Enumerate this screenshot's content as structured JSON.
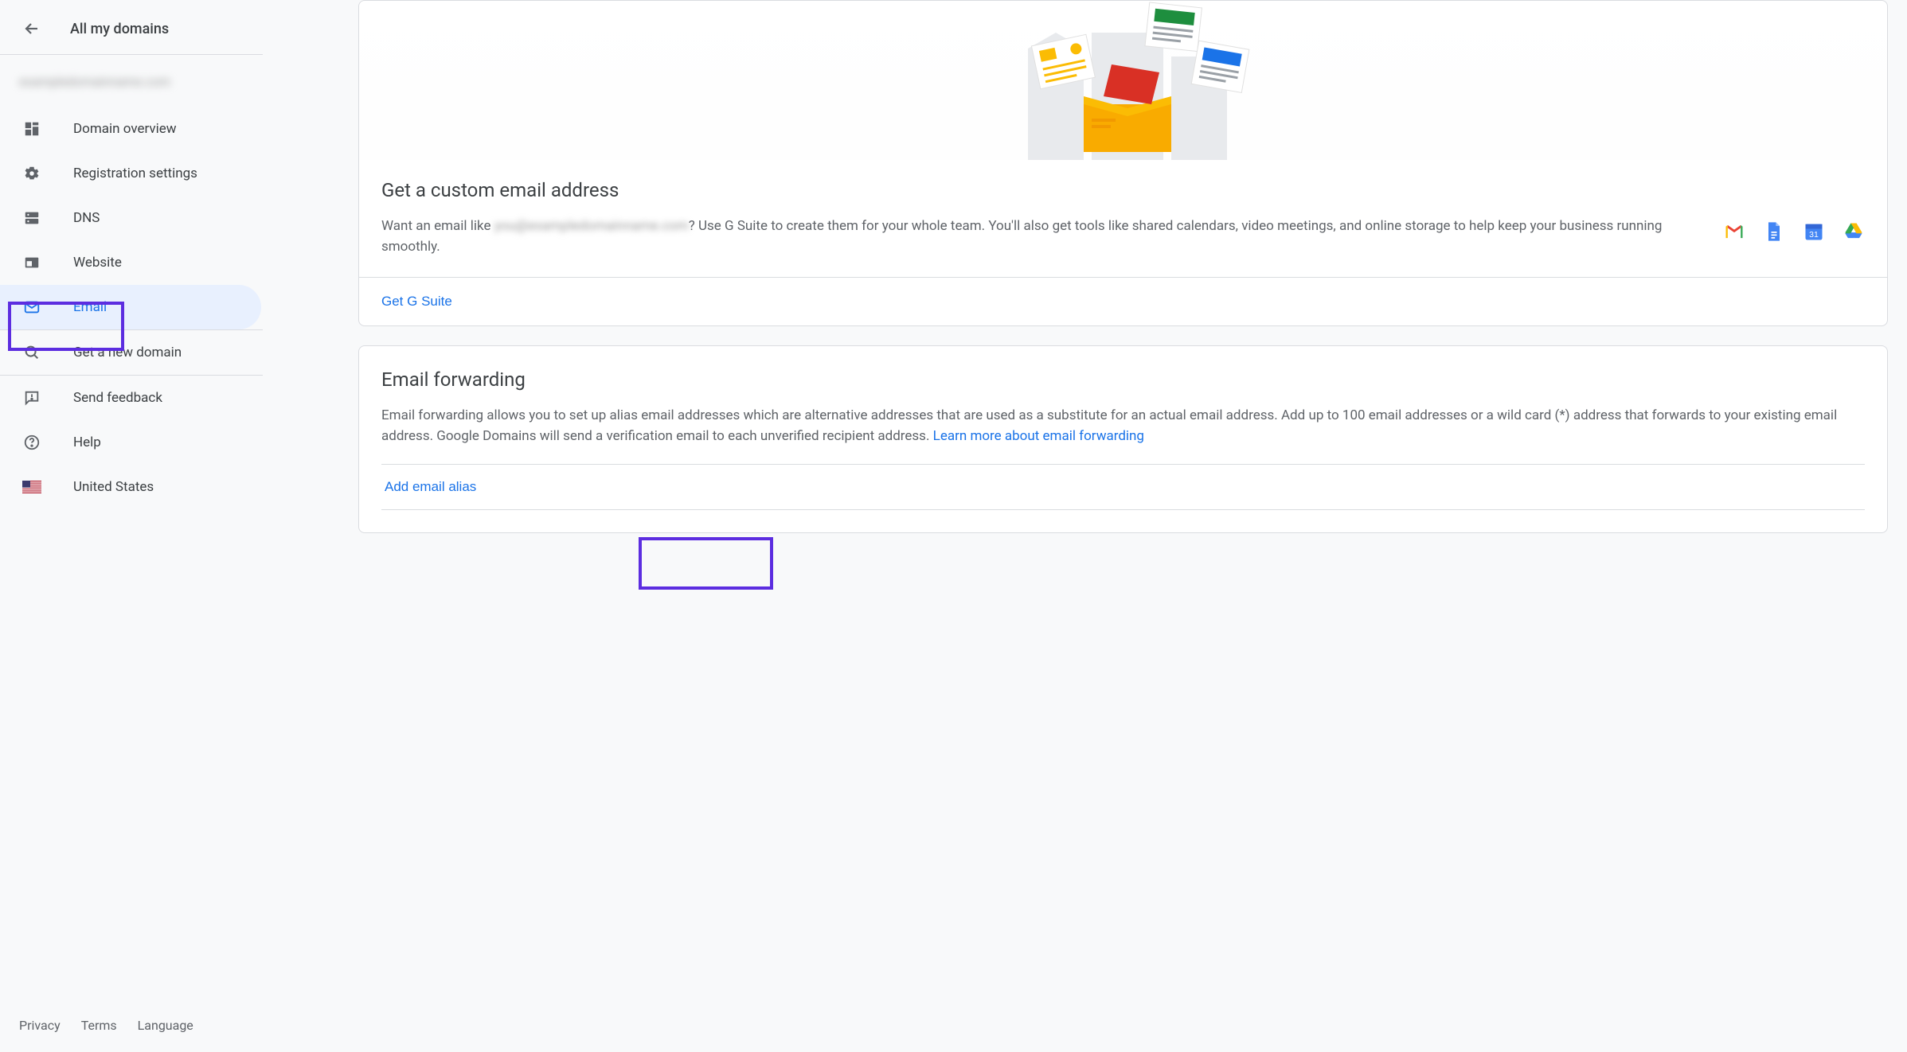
{
  "sidebar": {
    "back_title": "All my domains",
    "domain_placeholder": "exampledomainname.com",
    "items": [
      {
        "label": "Domain overview"
      },
      {
        "label": "Registration settings"
      },
      {
        "label": "DNS"
      },
      {
        "label": "Website"
      },
      {
        "label": "Email"
      },
      {
        "label": "Get a new domain"
      },
      {
        "label": "Send feedback"
      },
      {
        "label": "Help"
      },
      {
        "label": "United States"
      }
    ],
    "footer": {
      "privacy": "Privacy",
      "terms": "Terms",
      "language": "Language"
    }
  },
  "gsuite": {
    "title": "Get a custom email address",
    "text_prefix": "Want an email like ",
    "text_blurred": "you@exampledomainname.com",
    "text_suffix": "? Use G Suite to create them for your whole team. You'll also get tools like shared calendars, video meetings, and online storage to help keep your business running smoothly.",
    "cta": "Get G Suite"
  },
  "forwarding": {
    "title": "Email forwarding",
    "text": "Email forwarding allows you to set up alias email addresses which are alternative addresses that are used as a substitute for an actual email address. Add up to 100 email addresses or a wild card (*) address that forwards to your existing email address. Google Domains will send a verification email to each unverified recipient address. ",
    "learn_more": "Learn more about email forwarding",
    "add_alias": "Add email alias"
  }
}
